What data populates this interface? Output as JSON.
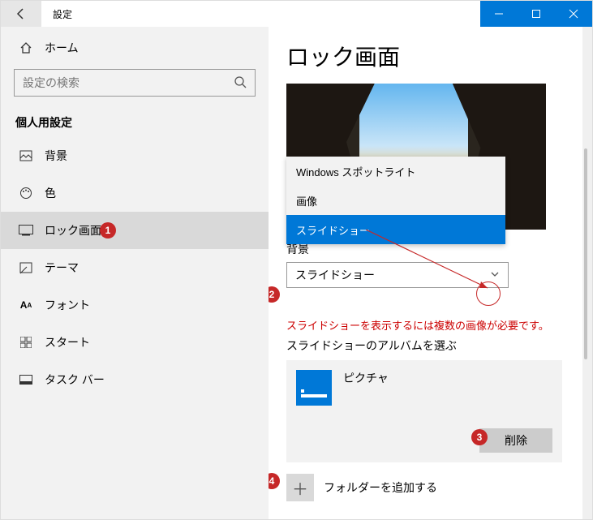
{
  "titlebar": {
    "title": "設定"
  },
  "sidebar": {
    "home": "ホーム",
    "search_placeholder": "設定の検索",
    "category": "個人用設定",
    "items": [
      {
        "label": "背景"
      },
      {
        "label": "色"
      },
      {
        "label": "ロック画面"
      },
      {
        "label": "テーマ"
      },
      {
        "label": "フォント"
      },
      {
        "label": "スタート"
      },
      {
        "label": "タスク バー"
      }
    ]
  },
  "page": {
    "title": "ロック画面",
    "dropdown": {
      "options": [
        "Windows スポットライト",
        "画像",
        "スライドショー"
      ],
      "selected": "スライドショー"
    },
    "bg_label": "背景",
    "combo_value": "スライドショー",
    "warning": "スライドショーを表示するには複数の画像が必要です。",
    "album_label": "スライドショーのアルバムを選ぶ",
    "album_name": "ピクチャ",
    "delete_label": "削除",
    "add_folder_label": "フォルダーを追加する"
  },
  "annotations": {
    "b1": "1",
    "b2": "2",
    "b3": "3",
    "b4": "4"
  }
}
